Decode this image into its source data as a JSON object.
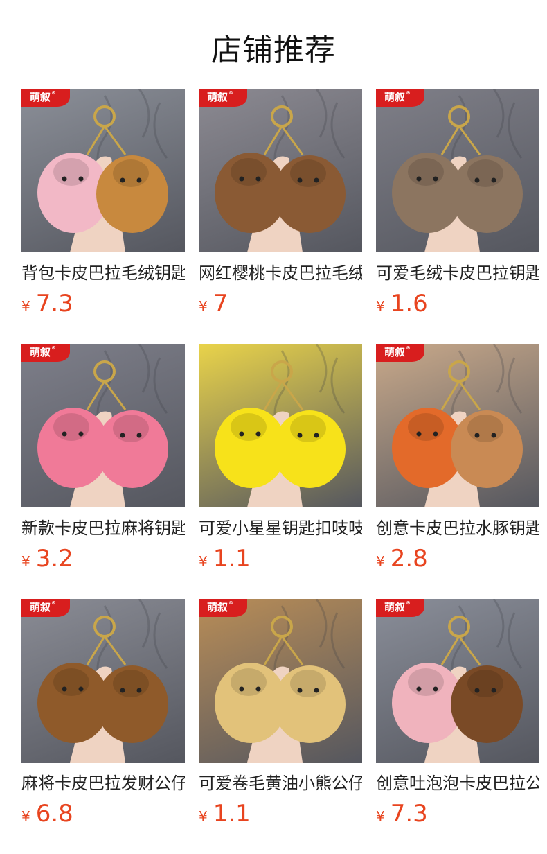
{
  "section": {
    "title": "店铺推荐"
  },
  "products": [
    {
      "name": "背包卡皮巴拉毛绒钥匙扣",
      "currency": "¥",
      "price": "7.3",
      "brand": "萌叙",
      "brand_mark": "®",
      "image_icon": "plush-capybara-pair-icon",
      "bg": "#8b8f98",
      "toy": "#c8893e",
      "toy2": "#f2b8c6"
    },
    {
      "name": "网红樱桃卡皮巴拉毛绒",
      "currency": "¥",
      "price": "7",
      "brand": "萌叙",
      "brand_mark": "®",
      "image_icon": "plush-capybara-cherry-icon",
      "bg": "#8c8a92",
      "toy": "#8a5a34",
      "toy2": "#8a5a34"
    },
    {
      "name": "可爱毛绒卡皮巴拉钥匙",
      "currency": "¥",
      "price": "1.6",
      "brand": "萌叙",
      "brand_mark": "®",
      "image_icon": "plush-capybara-fuzzy-icon",
      "bg": "#7f7f88",
      "toy": "#8c7560",
      "toy2": "#8c7560"
    },
    {
      "name": "新款卡皮巴拉麻将钥匙",
      "currency": "¥",
      "price": "3.2",
      "brand": "萌叙",
      "brand_mark": "®",
      "image_icon": "pink-capybara-mahjong-icon",
      "bg": "#7e7f8a",
      "toy": "#f07a98",
      "toy2": "#f07a98"
    },
    {
      "name": "可爱小星星钥匙扣吱吱",
      "currency": "¥",
      "price": "1.1",
      "brand": "",
      "brand_mark": "",
      "image_icon": "yellow-star-squishy-icon",
      "bg": "#e9d34a",
      "toy": "#f7e21a",
      "toy2": "#f7e21a"
    },
    {
      "name": "创意卡皮巴拉水豚钥匙",
      "currency": "¥",
      "price": "2.8",
      "brand": "萌叙",
      "brand_mark": "®",
      "image_icon": "capybara-strap-keychain-icon",
      "bg": "#c9a98a",
      "toy": "#c98a54",
      "toy2": "#e36a2a"
    },
    {
      "name": "麻将卡皮巴拉发财公仔",
      "currency": "¥",
      "price": "6.8",
      "brand": "萌叙",
      "brand_mark": "®",
      "image_icon": "plush-capybara-mahjong-icon",
      "bg": "#8a8c95",
      "toy": "#8f5a2a",
      "toy2": "#8f5a2a"
    },
    {
      "name": "可爱卷毛黄油小熊公仔",
      "currency": "¥",
      "price": "1.1",
      "brand": "萌叙",
      "brand_mark": "®",
      "image_icon": "curly-butter-bear-icon",
      "bg": "#b98d57",
      "toy": "#e2c27a",
      "toy2": "#e2c27a"
    },
    {
      "name": "创意吐泡泡卡皮巴拉公仔",
      "currency": "¥",
      "price": "7.3",
      "brand": "萌叙",
      "brand_mark": "®",
      "image_icon": "bubble-capybara-pig-icon",
      "bg": "#8a8e99",
      "toy": "#7a4a26",
      "toy2": "#f0b3bd"
    }
  ]
}
